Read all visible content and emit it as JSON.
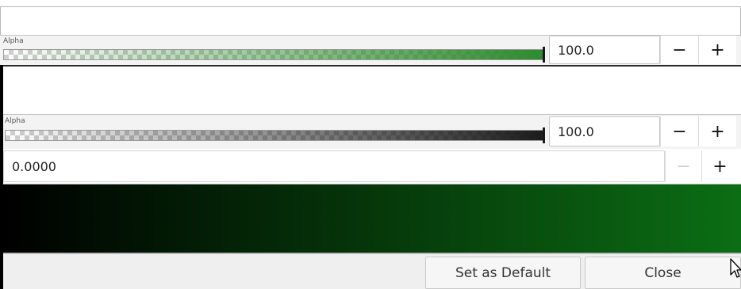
{
  "top_panel": {
    "alpha_label": "Alpha",
    "alpha_value": "100.0",
    "minus_label": "−",
    "plus_label": "+",
    "gradient_end_color": "#2e8b2e"
  },
  "main_panel": {
    "alpha_label": "Alpha",
    "alpha_value": "100.0",
    "minus_label": "−",
    "plus_label": "+",
    "gradient_end_color": "#1c1c1c",
    "spin_value": "0.0000",
    "spin_minus_label": "−",
    "spin_plus_label": "+",
    "preview_colors": [
      "#000000",
      "#0b6e14"
    ]
  },
  "footer": {
    "set_default_label": "Set as Default",
    "close_label": "Close"
  }
}
